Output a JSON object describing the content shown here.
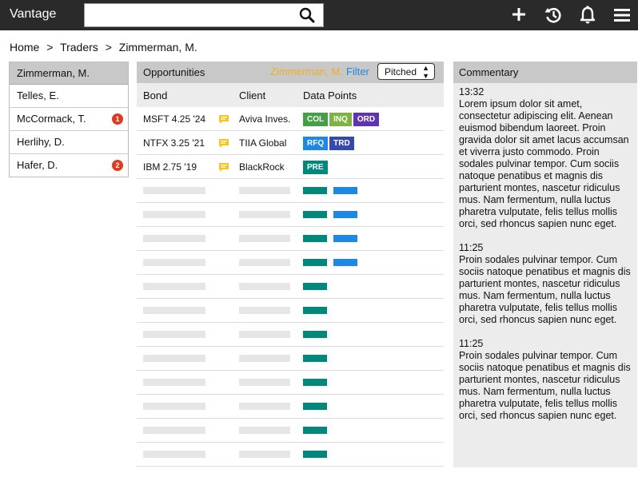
{
  "app": {
    "title": "Vantage"
  },
  "search": {
    "placeholder": "",
    "value": ""
  },
  "breadcrumb": [
    "Home",
    ">",
    "Traders",
    ">",
    "Zimmerman, M."
  ],
  "traders": {
    "header": "Zimmerman, M.",
    "items": [
      {
        "name": "Telles, E.",
        "badge": ""
      },
      {
        "name": "McCormack, T.",
        "badge": "1"
      },
      {
        "name": "Herlihy, D.",
        "badge": ""
      },
      {
        "name": "Hafer, D.",
        "badge": "2"
      }
    ]
  },
  "opportunities": {
    "title": "Opportunities",
    "filter_name": "Zimmerman, M.",
    "filter_label": "Filter",
    "select_value": "Pitched",
    "columns": [
      "Bond",
      "Client",
      "Data Points"
    ],
    "rows": [
      {
        "bond": "MSFT 4.25 '24",
        "client": "Aviva Inves.",
        "tags": [
          {
            "label": "COL",
            "color": "#43a047"
          },
          {
            "label": "INQ",
            "color": "#7cb342"
          },
          {
            "label": "ORD",
            "color": "#5e35b1"
          }
        ]
      },
      {
        "bond": "NTFX 3.25 '21",
        "client": "TIIA Global",
        "tags": [
          {
            "label": "RFQ",
            "color": "#1e88e5"
          },
          {
            "label": "TRD",
            "color": "#3949ab"
          }
        ]
      },
      {
        "bond": "IBM 2.75 '19",
        "client": "BlackRock",
        "tags": [
          {
            "label": "PRE",
            "color": "#00897b"
          }
        ]
      }
    ]
  },
  "commentary": {
    "title": "Commentary",
    "entries": [
      {
        "time": "13:32",
        "text": "Lorem ipsum dolor sit amet, consectetur adipiscing elit. Aenean euismod bibendum laoreet. Proin gravida dolor sit amet lacus accumsan et viverra justo commodo. Proin sodales pulvinar tempor. Cum sociis natoque penatibus et magnis dis parturient montes, nascetur ridiculus mus. Nam fermentum, nulla luctus pharetra vulputate, felis tellus mollis orci, sed rhoncus sapien nunc eget."
      },
      {
        "time": "11:25",
        "text": "Proin sodales pulvinar tempor. Cum sociis natoque penatibus et magnis dis parturient montes, nascetur ridiculus mus. Nam fermentum, nulla luctus pharetra vulputate, felis tellus mollis orci, sed rhoncus sapien nunc eget."
      },
      {
        "time": "11:25",
        "text": "Proin sodales pulvinar tempor. Cum sociis natoque penatibus et magnis dis parturient montes, nascetur ridiculus mus. Nam fermentum, nulla luctus pharetra vulputate, felis tellus mollis orci, sed rhoncus sapien nunc eget."
      }
    ]
  },
  "colors": {
    "teal": "#00897b",
    "blue": "#1e88e5",
    "badge": "#e03a1e",
    "comment_icon": "#f5c518"
  },
  "icons": [
    "search-icon",
    "add-icon",
    "history-icon",
    "bell-icon",
    "menu-icon",
    "comment-icon"
  ]
}
